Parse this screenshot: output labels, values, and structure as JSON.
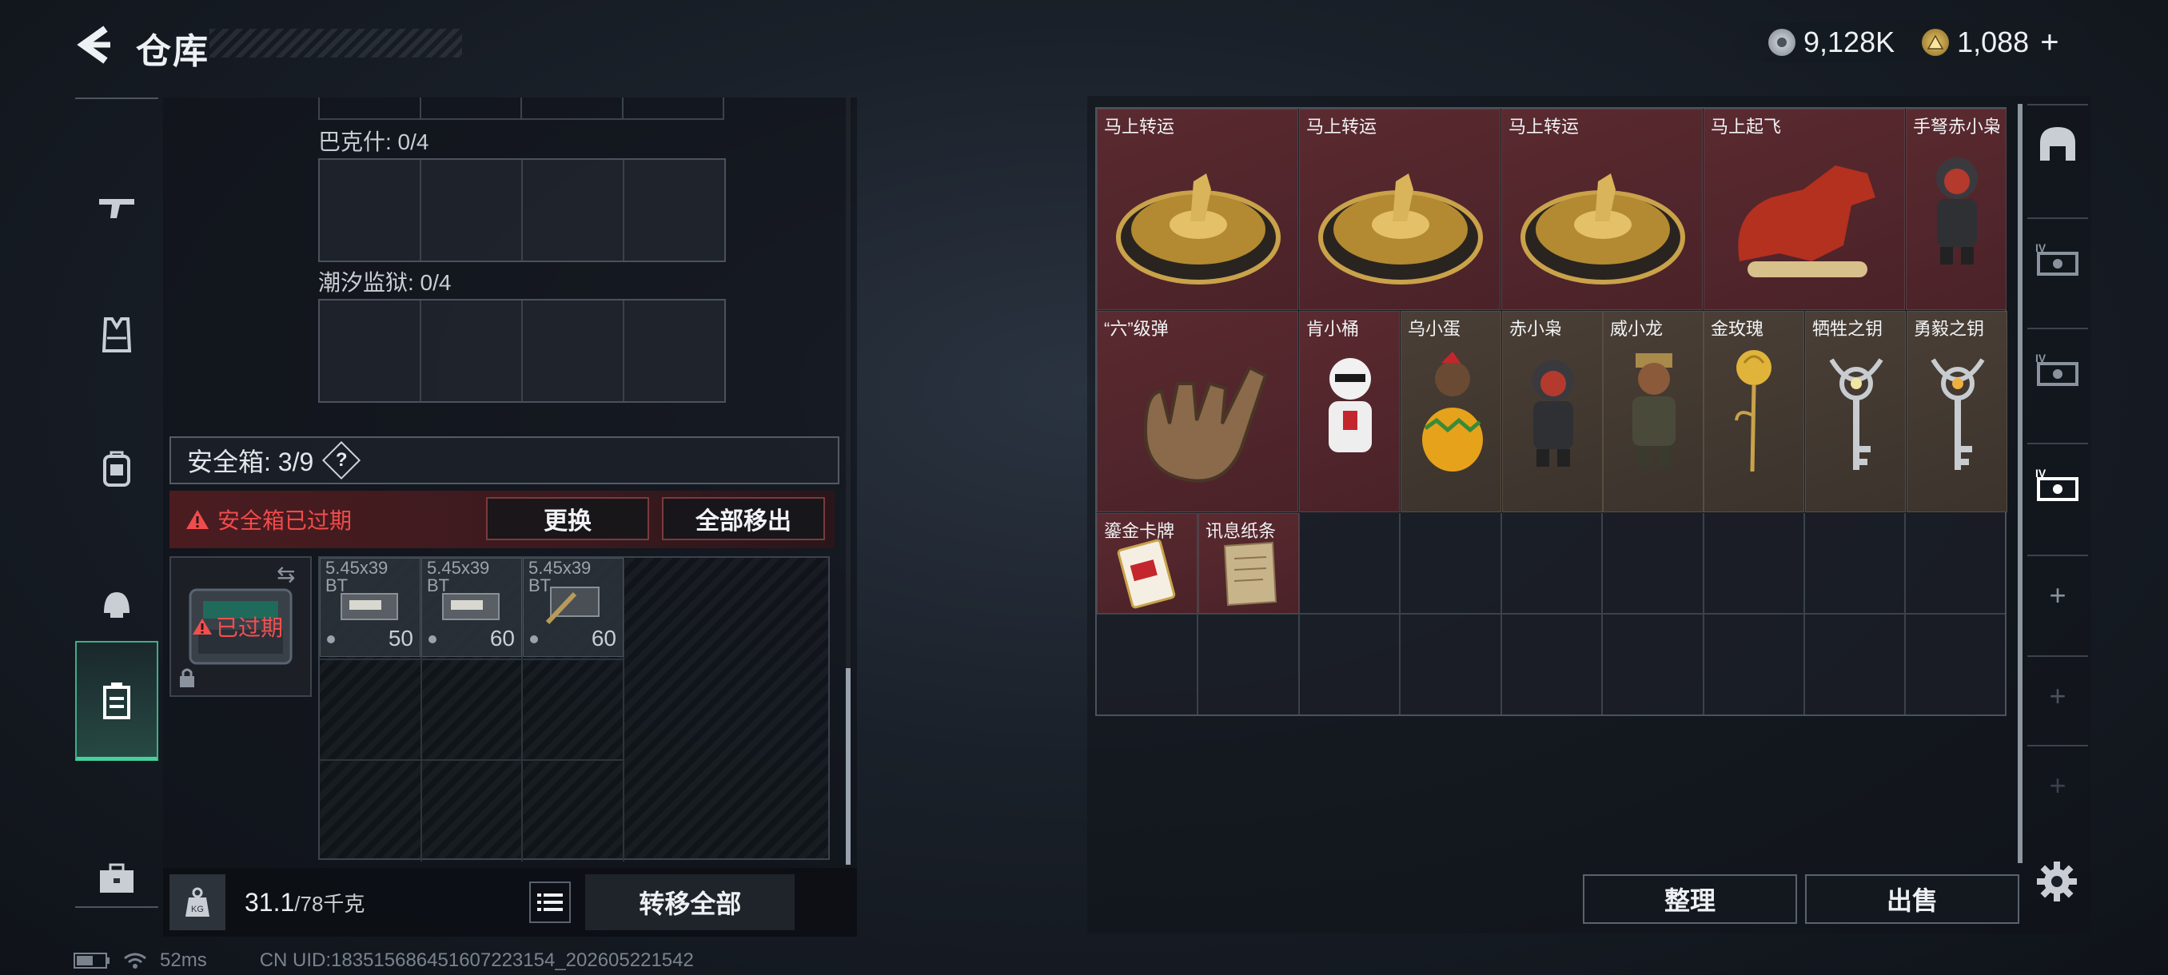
{
  "header": {
    "title": "仓库",
    "currency": [
      {
        "icon": "silver-coin-icon",
        "amount": "9,128K"
      },
      {
        "icon": "gold-triangle-coin-icon",
        "amount": "1,088"
      }
    ],
    "plus": "+"
  },
  "nav": {
    "items": [
      {
        "name": "nav-weapons",
        "icon": "rifle-icon"
      },
      {
        "name": "nav-armor",
        "icon": "vest-icon"
      },
      {
        "name": "nav-backpack",
        "icon": "backpack-icon"
      },
      {
        "name": "nav-helmet",
        "icon": "helmet-icon"
      },
      {
        "name": "nav-safebox",
        "icon": "safebox-icon",
        "active": true
      },
      {
        "name": "nav-case",
        "icon": "briefcase-icon"
      }
    ]
  },
  "left": {
    "section1": {
      "label": "巴克什: 0/4"
    },
    "section2": {
      "label": "潮汐监狱: 0/4"
    },
    "safebox": {
      "label": "安全箱: 3/9",
      "help": "?"
    },
    "expired_warning": "安全箱已过期",
    "replace_btn": "更换",
    "remove_all_btn": "全部移出",
    "expired_tag": "已过期",
    "ammo": [
      {
        "name": "5.45x39",
        "sub": "BT",
        "count": "50"
      },
      {
        "name": "5.45x39",
        "sub": "BT",
        "count": "60"
      },
      {
        "name": "5.45x39",
        "sub": "BT",
        "count": "60"
      }
    ],
    "weight": {
      "current": "31.1",
      "max": "/78千克"
    },
    "transfer_all": "转移全部"
  },
  "status": {
    "ping": "52ms",
    "uid": "CN UID:183515686451607223154_202605221542"
  },
  "storage": {
    "items": [
      {
        "label": "马上转运",
        "color": "red"
      },
      {
        "label": "马上转运",
        "color": "red"
      },
      {
        "label": "马上转运",
        "color": "red"
      },
      {
        "label": "马上起飞",
        "color": "red"
      },
      {
        "label": "手弩赤小枭",
        "color": "red"
      },
      {
        "label": "“六”级弹",
        "color": "red"
      },
      {
        "label": "肯小桶",
        "color": "red"
      },
      {
        "label": "乌小蛋",
        "color": "tan"
      },
      {
        "label": "赤小枭",
        "color": "tan"
      },
      {
        "label": "威小龙",
        "color": "tan"
      },
      {
        "label": "金玫瑰",
        "color": "tan"
      },
      {
        "label": "牺牲之钥",
        "color": "tan"
      },
      {
        "label": "勇毅之钥",
        "color": "tan"
      },
      {
        "label": "鎏金卡牌",
        "color": "red"
      },
      {
        "label": "讯息纸条",
        "color": "red"
      }
    ],
    "sort_btn": "整理",
    "sell_btn": "出售"
  },
  "right_tabs": [
    {
      "icon": "helmet-tab-icon"
    },
    {
      "icon": "safebox-lv4-icon"
    },
    {
      "icon": "safebox-lv4-icon"
    },
    {
      "icon": "safebox-lv4-active-icon"
    },
    {
      "icon": "plus-icon",
      "text": "+"
    },
    {
      "icon": "plus-icon",
      "text": "+"
    },
    {
      "icon": "plus-icon",
      "text": "+"
    }
  ],
  "colors": {
    "accent_green": "#44d19b",
    "warning_red": "#f24b4b",
    "item_red": "#5a2a30",
    "item_tan": "#4a3f36"
  }
}
